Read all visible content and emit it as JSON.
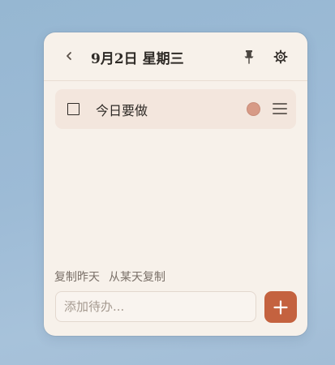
{
  "header": {
    "date_title": "9月2日 星期三",
    "back_icon": "chevron-left-icon",
    "pin_icon": "pushpin-icon",
    "settings_icon": "gear-icon"
  },
  "todos": [
    {
      "label": "今日要做",
      "checked": false,
      "color": "#d79a86"
    }
  ],
  "quick_actions": {
    "copy_yesterday": "复制昨天",
    "copy_from_day": "从某天复制"
  },
  "add_todo": {
    "placeholder": "添加待办...",
    "value": "",
    "button_icon": "plus-icon"
  },
  "colors": {
    "accent": "#c4623f",
    "panel_background": "#f7f1ea",
    "item_background": "#f3e6dd"
  }
}
